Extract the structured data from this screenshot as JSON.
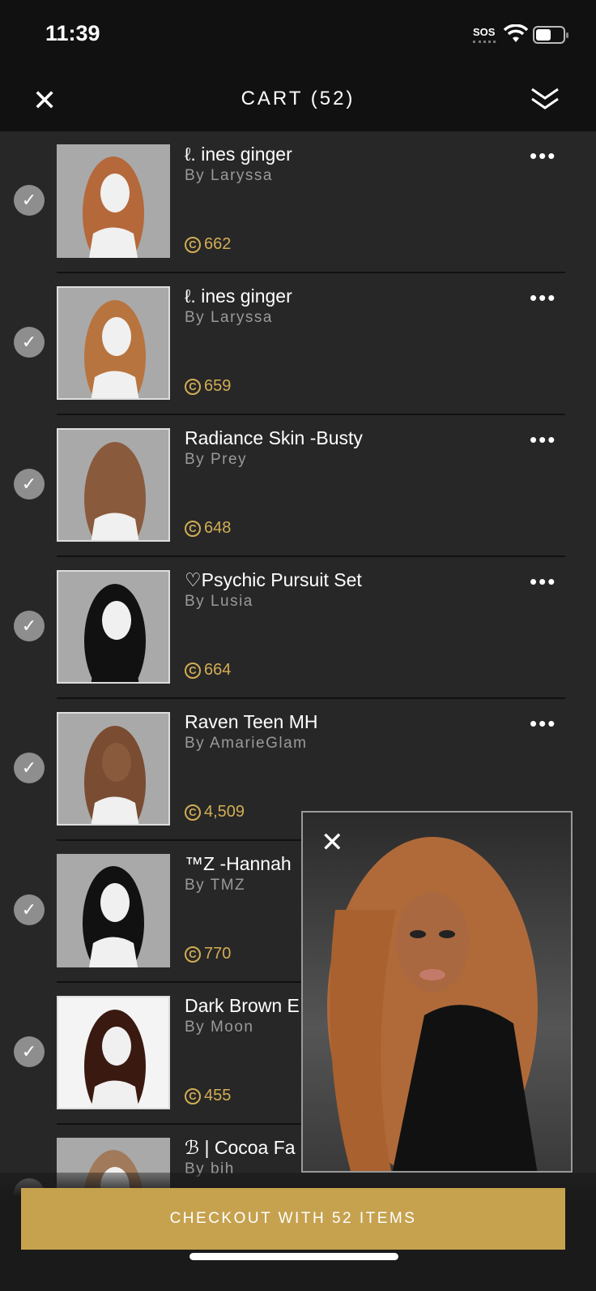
{
  "status_bar": {
    "time": "11:39",
    "sos": "SOS",
    "battery_level": 0.5
  },
  "header": {
    "title": "CART (52)",
    "close_icon": "close-icon",
    "collapse_icon": "double-chevron-down-icon"
  },
  "items": [
    {
      "name": "ℓ. ines ginger",
      "by": "By Laryssa",
      "price": "662",
      "thumb_color": "#b5683a",
      "selected": true
    },
    {
      "name": "ℓ. ines ginger",
      "by": "By Laryssa",
      "price": "659",
      "thumb_color": "#b8743f",
      "selected": true
    },
    {
      "name": "Radiance Skin -Busty",
      "by": "By Prey",
      "price": "648",
      "thumb_color": "#8a5a3c",
      "selected": true
    },
    {
      "name": "♡Psychic Pursuit Set",
      "by": "By Lusia",
      "price": "664",
      "thumb_color": "#111111",
      "selected": true
    },
    {
      "name": "Raven Teen MH",
      "by": "By AmarieGlam",
      "price": "4,509",
      "thumb_color": "#7a4c32",
      "selected": true
    },
    {
      "name": "™Z -Hannah",
      "by": "By TMZ",
      "price": "770",
      "thumb_color": "#111111",
      "selected": true
    },
    {
      "name": "Dark Brown E",
      "by": "By Moon",
      "price": "455",
      "thumb_color": "#3a1a10",
      "selected": true
    },
    {
      "name": "ℬ | Cocoa Fa",
      "by": "By bih",
      "price": "",
      "thumb_color": "#a07a5a",
      "selected": true
    }
  ],
  "preview": {
    "close_icon": "close-icon"
  },
  "checkout": {
    "label": "CHECKOUT WITH 52 ITEMS",
    "color": "#c6a24f"
  },
  "colors": {
    "price": "#d2ad55",
    "background": "#272727",
    "header": "#111111"
  }
}
